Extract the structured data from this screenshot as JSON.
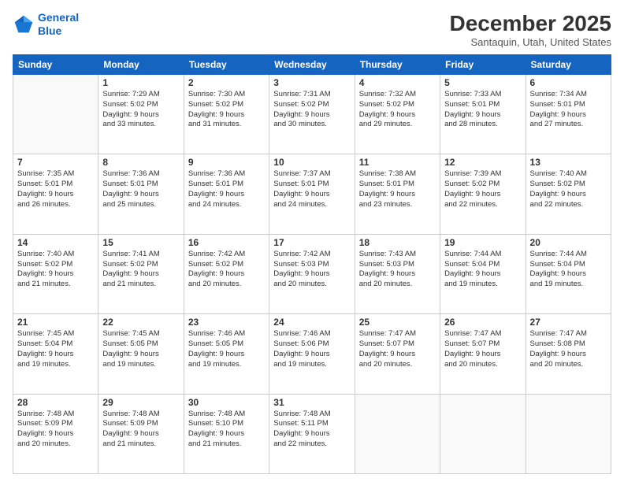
{
  "header": {
    "logo_line1": "General",
    "logo_line2": "Blue",
    "title": "December 2025",
    "subtitle": "Santaquin, Utah, United States"
  },
  "weekdays": [
    "Sunday",
    "Monday",
    "Tuesday",
    "Wednesday",
    "Thursday",
    "Friday",
    "Saturday"
  ],
  "weeks": [
    [
      {
        "day": "",
        "info": ""
      },
      {
        "day": "1",
        "info": "Sunrise: 7:29 AM\nSunset: 5:02 PM\nDaylight: 9 hours\nand 33 minutes."
      },
      {
        "day": "2",
        "info": "Sunrise: 7:30 AM\nSunset: 5:02 PM\nDaylight: 9 hours\nand 31 minutes."
      },
      {
        "day": "3",
        "info": "Sunrise: 7:31 AM\nSunset: 5:02 PM\nDaylight: 9 hours\nand 30 minutes."
      },
      {
        "day": "4",
        "info": "Sunrise: 7:32 AM\nSunset: 5:02 PM\nDaylight: 9 hours\nand 29 minutes."
      },
      {
        "day": "5",
        "info": "Sunrise: 7:33 AM\nSunset: 5:01 PM\nDaylight: 9 hours\nand 28 minutes."
      },
      {
        "day": "6",
        "info": "Sunrise: 7:34 AM\nSunset: 5:01 PM\nDaylight: 9 hours\nand 27 minutes."
      }
    ],
    [
      {
        "day": "7",
        "info": "Sunrise: 7:35 AM\nSunset: 5:01 PM\nDaylight: 9 hours\nand 26 minutes."
      },
      {
        "day": "8",
        "info": "Sunrise: 7:36 AM\nSunset: 5:01 PM\nDaylight: 9 hours\nand 25 minutes."
      },
      {
        "day": "9",
        "info": "Sunrise: 7:36 AM\nSunset: 5:01 PM\nDaylight: 9 hours\nand 24 minutes."
      },
      {
        "day": "10",
        "info": "Sunrise: 7:37 AM\nSunset: 5:01 PM\nDaylight: 9 hours\nand 24 minutes."
      },
      {
        "day": "11",
        "info": "Sunrise: 7:38 AM\nSunset: 5:01 PM\nDaylight: 9 hours\nand 23 minutes."
      },
      {
        "day": "12",
        "info": "Sunrise: 7:39 AM\nSunset: 5:02 PM\nDaylight: 9 hours\nand 22 minutes."
      },
      {
        "day": "13",
        "info": "Sunrise: 7:40 AM\nSunset: 5:02 PM\nDaylight: 9 hours\nand 22 minutes."
      }
    ],
    [
      {
        "day": "14",
        "info": "Sunrise: 7:40 AM\nSunset: 5:02 PM\nDaylight: 9 hours\nand 21 minutes."
      },
      {
        "day": "15",
        "info": "Sunrise: 7:41 AM\nSunset: 5:02 PM\nDaylight: 9 hours\nand 21 minutes."
      },
      {
        "day": "16",
        "info": "Sunrise: 7:42 AM\nSunset: 5:02 PM\nDaylight: 9 hours\nand 20 minutes."
      },
      {
        "day": "17",
        "info": "Sunrise: 7:42 AM\nSunset: 5:03 PM\nDaylight: 9 hours\nand 20 minutes."
      },
      {
        "day": "18",
        "info": "Sunrise: 7:43 AM\nSunset: 5:03 PM\nDaylight: 9 hours\nand 20 minutes."
      },
      {
        "day": "19",
        "info": "Sunrise: 7:44 AM\nSunset: 5:04 PM\nDaylight: 9 hours\nand 19 minutes."
      },
      {
        "day": "20",
        "info": "Sunrise: 7:44 AM\nSunset: 5:04 PM\nDaylight: 9 hours\nand 19 minutes."
      }
    ],
    [
      {
        "day": "21",
        "info": "Sunrise: 7:45 AM\nSunset: 5:04 PM\nDaylight: 9 hours\nand 19 minutes."
      },
      {
        "day": "22",
        "info": "Sunrise: 7:45 AM\nSunset: 5:05 PM\nDaylight: 9 hours\nand 19 minutes."
      },
      {
        "day": "23",
        "info": "Sunrise: 7:46 AM\nSunset: 5:05 PM\nDaylight: 9 hours\nand 19 minutes."
      },
      {
        "day": "24",
        "info": "Sunrise: 7:46 AM\nSunset: 5:06 PM\nDaylight: 9 hours\nand 19 minutes."
      },
      {
        "day": "25",
        "info": "Sunrise: 7:47 AM\nSunset: 5:07 PM\nDaylight: 9 hours\nand 20 minutes."
      },
      {
        "day": "26",
        "info": "Sunrise: 7:47 AM\nSunset: 5:07 PM\nDaylight: 9 hours\nand 20 minutes."
      },
      {
        "day": "27",
        "info": "Sunrise: 7:47 AM\nSunset: 5:08 PM\nDaylight: 9 hours\nand 20 minutes."
      }
    ],
    [
      {
        "day": "28",
        "info": "Sunrise: 7:48 AM\nSunset: 5:09 PM\nDaylight: 9 hours\nand 20 minutes."
      },
      {
        "day": "29",
        "info": "Sunrise: 7:48 AM\nSunset: 5:09 PM\nDaylight: 9 hours\nand 21 minutes."
      },
      {
        "day": "30",
        "info": "Sunrise: 7:48 AM\nSunset: 5:10 PM\nDaylight: 9 hours\nand 21 minutes."
      },
      {
        "day": "31",
        "info": "Sunrise: 7:48 AM\nSunset: 5:11 PM\nDaylight: 9 hours\nand 22 minutes."
      },
      {
        "day": "",
        "info": ""
      },
      {
        "day": "",
        "info": ""
      },
      {
        "day": "",
        "info": ""
      }
    ]
  ]
}
